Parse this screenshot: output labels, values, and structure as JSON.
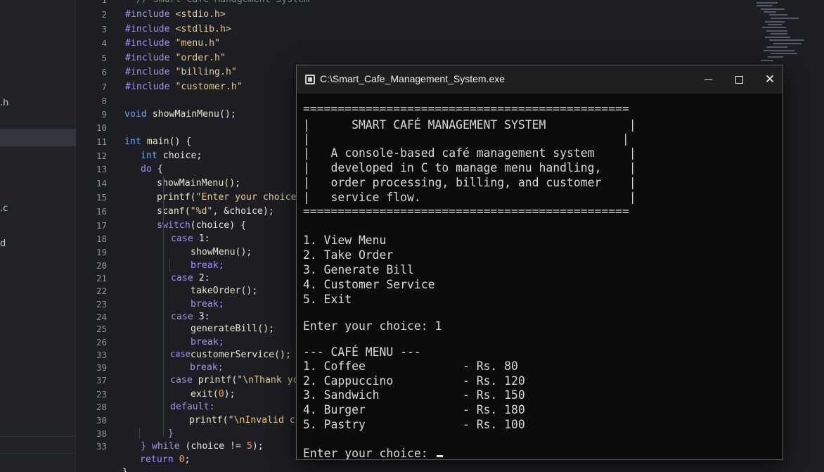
{
  "sidebar": {
    "items": [
      ".h",
      ".c",
      "d"
    ]
  },
  "editor": {
    "lines": [
      {
        "n": "1",
        "top": "-8"
      },
      {
        "n": "2"
      },
      {
        "n": "3"
      },
      {
        "n": "4"
      },
      {
        "n": "5"
      },
      {
        "n": "6"
      },
      {
        "n": "7"
      },
      {
        "n": "8"
      },
      {
        "n": "9"
      },
      {
        "n": "10"
      },
      {
        "n": "11"
      },
      {
        "n": "12"
      },
      {
        "n": "13"
      },
      {
        "n": "14"
      },
      {
        "n": "15"
      },
      {
        "n": "16"
      },
      {
        "n": "17"
      },
      {
        "n": "18"
      },
      {
        "n": "19"
      },
      {
        "n": "20"
      },
      {
        "n": "21"
      },
      {
        "n": "22"
      },
      {
        "n": "23"
      },
      {
        "n": "24"
      },
      {
        "n": "25"
      },
      {
        "n": "26"
      },
      {
        "n": "33"
      },
      {
        "n": "39"
      },
      {
        "n": "37"
      },
      {
        "n": "23"
      },
      {
        "n": "28"
      },
      {
        "n": "30"
      },
      {
        "n": "38"
      },
      {
        "n": "33"
      }
    ],
    "code": {
      "l1": "// Smart Cafe Management System",
      "inc1": "#include",
      "inc1v": "<stdio.h>",
      "inc2": "#include",
      "inc2v": "<stdlib.h>",
      "inc3": "#include",
      "inc3v": "\"menu.h\"",
      "inc4": "#include",
      "inc4v": "\"order.h\"",
      "inc5": "#include",
      "inc5v": "\"billing.h\"",
      "inc6": "#include",
      "inc6v": "\"customer.h\"",
      "decl_type": "void",
      "decl_rest": "showMainMenu();",
      "main_type": "int",
      "main_rest": "main() {",
      "choice_type": "int",
      "choice_rest": " choice;",
      "do_kw": "do",
      "do_rest": " {",
      "call1": "showMainMenu();",
      "printf1": "printf(",
      "printf1s": "\"Enter your choice: \"",
      "scanf1": "scanf(",
      "scanf1s": "\"%d\"",
      "scanf1r": ", &choice);",
      "switch_kw": "switch",
      "switch_rest": "(choice) {",
      "case1_kw": "case",
      "case1_v": " 1:",
      "call_showMenu": "showMenu();",
      "break1": "break;",
      "case2_kw": "case",
      "case2_v": " 2:",
      "call_takeOrder": "takeOrder();",
      "break2": "break;",
      "case3_kw": "case",
      "case3_v": " 3:",
      "call_generateBill": "generateBill();",
      "break3": "break;",
      "case4_kw": "case",
      "call_customerService": "customerService();",
      "break4": "break;",
      "case5_kw": "case",
      "case5_rest": " printf(",
      "case5_s": "\"\\nThank you fo",
      "exit_call": "exit(",
      "exit_n": "0",
      "exit_end": ");",
      "default_kw": "default:",
      "printf2": "printf(",
      "printf2s": "\"\\nInvalid choi",
      "close1": "}",
      "while_kw": "} while",
      "while_rest": " (choice != ",
      "while_n": "5",
      "while_end": ");",
      "return_kw": "return",
      "return_n": "0",
      "return_end": ";",
      "close2": "}"
    }
  },
  "window": {
    "title": "C:\\Smart_Cafe_Management_System.exe",
    "minimize": "minimize",
    "maximize": "maximize",
    "close": "✕"
  },
  "console": {
    "rule": "===============================================",
    "banner_title": "|      SMART CAFÉ MANAGEMENT SYSTEM            |",
    "banner_empty": "|                                             |",
    "desc1": "|   A console-based café management system     |",
    "desc2": "|   developed in C to manage menu handling,    |",
    "desc3": "|   order processing, billing, and customer    |",
    "desc4": "|   service flow.                              |",
    "rule2": "===============================================",
    "menu": [
      "1. View Menu",
      "2. Take Order",
      "3. Generate Bill",
      "4. Customer Service",
      "5. Exit"
    ],
    "prompt1": "Enter your choice: 1",
    "cafe_menu_header": "--- CAFÉ MENU ---",
    "items": [
      "1. Coffee              - Rs. 80",
      "2. Cappuccino          - Rs. 120",
      "3. Sandwich            - Rs. 150",
      "4. Burger              - Rs. 180",
      "5. Pastry              - Rs. 100"
    ],
    "prompt2": "Enter your choice: "
  }
}
